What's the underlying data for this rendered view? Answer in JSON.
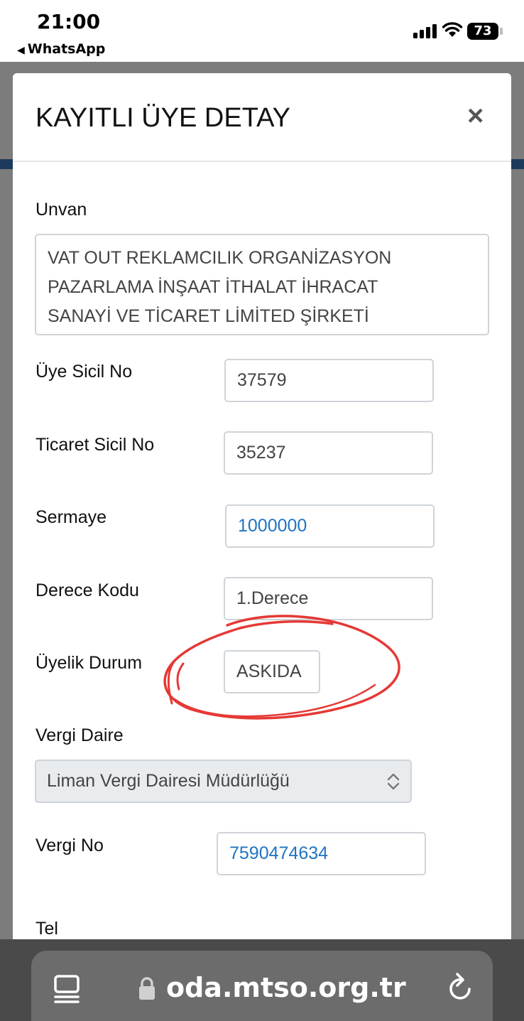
{
  "status_bar": {
    "time": "21:00",
    "back_app": "WhatsApp",
    "battery": "73"
  },
  "modal": {
    "title": "KAYITLI ÜYE DETAY",
    "close_label": "×",
    "unvan": {
      "label": "Unvan",
      "value_lines": [
        "VAT OUT REKLAMCILIK ORGANİZASYON",
        "PAZARLAMA İNŞAAT İTHALAT İHRACAT",
        "SANAYİ VE TİCARET LİMİTED ŞİRKETİ"
      ]
    },
    "uye_sicil_no": {
      "label": "Üye Sicil No",
      "value": "37579"
    },
    "ticaret_sicil_no": {
      "label": "Ticaret Sicil No",
      "value": "35237"
    },
    "sermaye": {
      "label": "Sermaye",
      "value": "1000000"
    },
    "derece_kodu": {
      "label": "Derece Kodu",
      "value": "1.Derece"
    },
    "uyelik_durum": {
      "label": "Üyelik Durum",
      "value": "ASKIDA"
    },
    "vergi_daire": {
      "label": "Vergi Daire",
      "selected": "Liman Vergi Dairesi Müdürlüğü"
    },
    "vergi_no": {
      "label": "Vergi No",
      "value": "7590474634"
    },
    "tel": {
      "label": "Tel"
    }
  },
  "browser": {
    "url": "oda.mtso.org.tr",
    "tabs_icon": "tabs-icon",
    "lock_icon": "lock-icon",
    "reload_icon": "reload-icon"
  },
  "colors": {
    "link_value": "#1f73c4",
    "annotation": "#e53935",
    "backdrop": "#7c7c7c",
    "browser_bar": "#4a4a4a"
  }
}
